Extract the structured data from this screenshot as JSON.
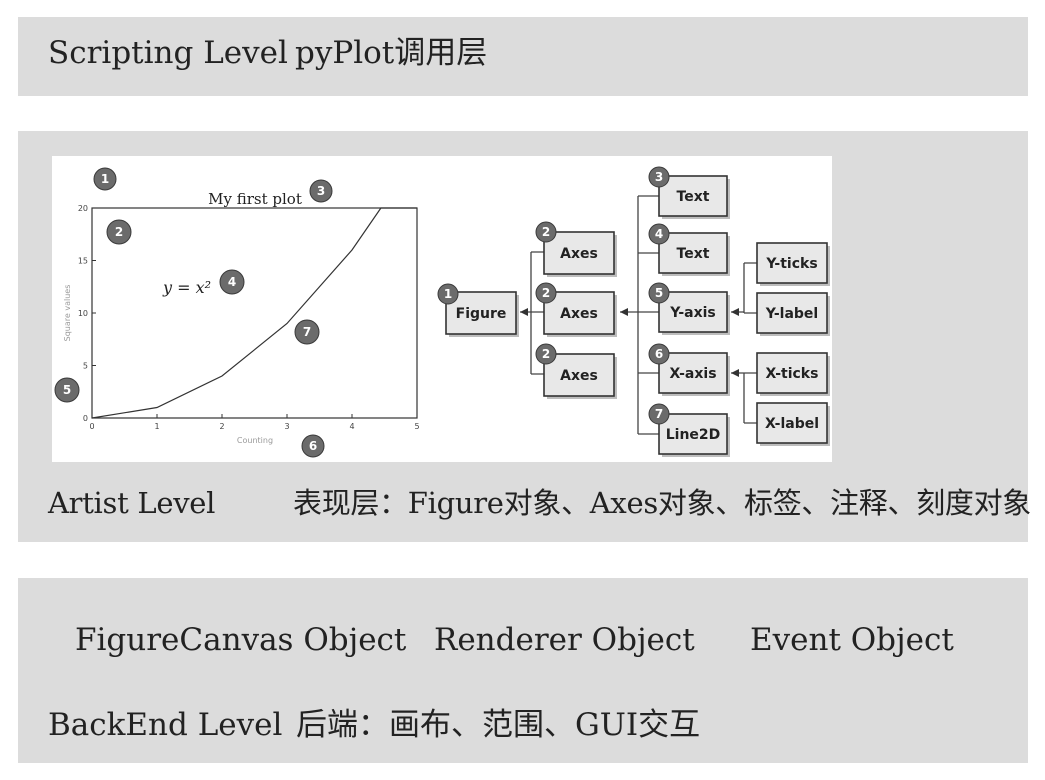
{
  "scripting": {
    "name": "Scripting Level",
    "desc": "pyPlot调用层"
  },
  "artist": {
    "name": "Artist Level",
    "desc": "表现层：Figure对象、Axes对象、标签、注释、刻度对象"
  },
  "backend": {
    "objects": [
      "FigureCanvas Object",
      "Renderer Object",
      "Event Object"
    ],
    "name": "BackEnd Level",
    "desc": "后端：画布、范围、GUI交互"
  },
  "plot": {
    "title": "My first plot",
    "equation": "y = x²",
    "xlabel": "Counting",
    "ylabel": "Square values",
    "badges": [
      "1",
      "2",
      "3",
      "4",
      "5",
      "6",
      "7"
    ]
  },
  "hierarchy": {
    "figure": {
      "label": "Figure",
      "badge": "1"
    },
    "axes": [
      {
        "label": "Axes",
        "badge": "2"
      },
      {
        "label": "Axes",
        "badge": "2"
      },
      {
        "label": "Axes",
        "badge": "2"
      }
    ],
    "children": [
      {
        "label": "Text",
        "badge": "3"
      },
      {
        "label": "Text",
        "badge": "4"
      },
      {
        "label": "Y-axis",
        "badge": "5"
      },
      {
        "label": "X-axis",
        "badge": "6"
      },
      {
        "label": "Line2D",
        "badge": "7"
      }
    ],
    "y_leaves": [
      "Y-ticks",
      "Y-label"
    ],
    "x_leaves": [
      "X-ticks",
      "X-label"
    ]
  },
  "chart_data": {
    "type": "line",
    "title": "My first plot",
    "xlabel": "Counting",
    "ylabel": "Square values",
    "x": [
      0,
      1,
      2,
      3,
      4,
      5
    ],
    "y": [
      0,
      1,
      4,
      9,
      16,
      25
    ],
    "xlim": [
      0,
      5
    ],
    "ylim": [
      0,
      20
    ],
    "xticks": [
      "0",
      "1",
      "2",
      "3",
      "4",
      "5"
    ],
    "yticks": [
      "0",
      "5",
      "10",
      "15",
      "20"
    ],
    "annotations": [
      "y = x²"
    ]
  }
}
